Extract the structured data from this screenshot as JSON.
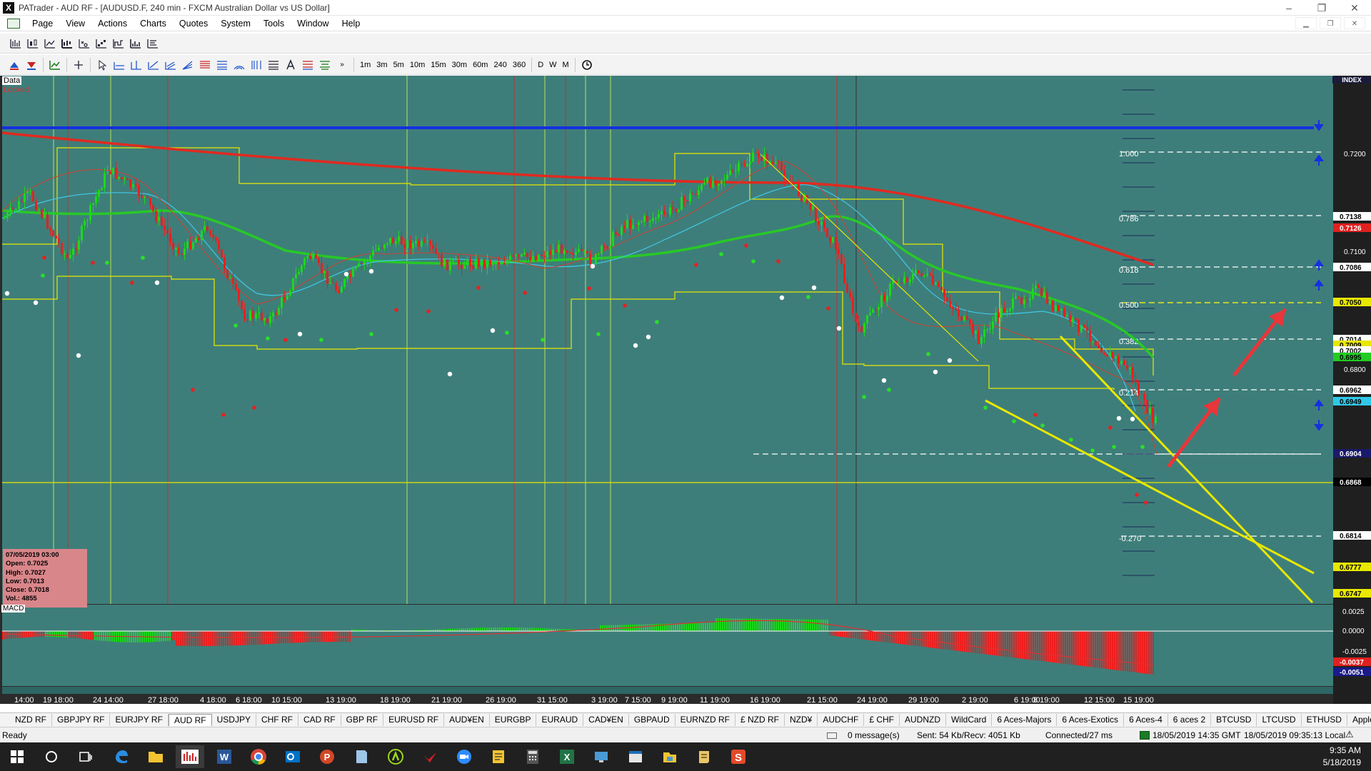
{
  "window": {
    "title": "PATrader - AUD RF - [AUDUSD.F, 240 min - FXCM Australian Dollar vs US Dollar]",
    "controls": [
      "–",
      "❐",
      "✕"
    ]
  },
  "menu": [
    "Page",
    "View",
    "Actions",
    "Charts",
    "Quotes",
    "System",
    "Tools",
    "Window",
    "Help"
  ],
  "timeframes": [
    "1m",
    "3m",
    "5m",
    "10m",
    "15m",
    "30m",
    "60m",
    "240",
    "360"
  ],
  "periods": [
    "D",
    "W",
    "M"
  ],
  "chart": {
    "data_label": "Data",
    "locked_label": "Locked",
    "index_label": "INDEX",
    "macd_label": "MACD",
    "ohlc": {
      "date": "07/05/2019 03:00",
      "open": "Open: 0.7025",
      "high": "High: 0.7027",
      "low": "Low: 0.7013",
      "close": "Close: 0.7018",
      "vol": "Vol.: 4855"
    },
    "price_axis": [
      "0.7200",
      "0.7100",
      "0.6800"
    ],
    "price_markers": [
      {
        "label": "0.7138",
        "bg": "#ffffff",
        "fg": "#000000"
      },
      {
        "label": "0.7126",
        "bg": "#e02020",
        "fg": "#ffffff"
      },
      {
        "label": "0.7086",
        "bg": "#ffffff",
        "fg": "#000000"
      },
      {
        "label": "0.7050",
        "bg": "#e8e800",
        "fg": "#000000"
      },
      {
        "label": "0.7014",
        "bg": "#ffffff",
        "fg": "#000000"
      },
      {
        "label": "0.7009",
        "bg": "#e8e800",
        "fg": "#000000"
      },
      {
        "label": "0.7002",
        "bg": "#ffffff",
        "fg": "#000000"
      },
      {
        "label": "0.6995",
        "bg": "#22cc22",
        "fg": "#000000"
      },
      {
        "label": "0.6962",
        "bg": "#ffffff",
        "fg": "#000000"
      },
      {
        "label": "0.6949",
        "bg": "#30c8e8",
        "fg": "#000000"
      },
      {
        "label": "0.6904",
        "bg": "#1a1a6a",
        "fg": "#ffffff"
      },
      {
        "label": "0.6868",
        "bg": "#000000",
        "fg": "#ffffff"
      },
      {
        "label": "0.6814",
        "bg": "#ffffff",
        "fg": "#000000"
      },
      {
        "label": "0.6777",
        "bg": "#e8e800",
        "fg": "#000000"
      },
      {
        "label": "0.6747",
        "bg": "#e8e800",
        "fg": "#000000"
      }
    ],
    "fib_levels": [
      "1.000",
      "0.786",
      "0.618",
      "0.500",
      "0.382",
      "0.214",
      "-0.270"
    ],
    "macd_axis": [
      "0.0025",
      "0.0000",
      "-0.0025"
    ],
    "macd_markers": [
      {
        "label": "-0.0037",
        "bg": "#e02020",
        "fg": "#ffffff"
      },
      {
        "label": "-0.0051",
        "bg": "#1a1a8a",
        "fg": "#ffffff"
      }
    ],
    "time_labels": [
      "14:00",
      "19 18:00",
      "24 14:00",
      "27 18:00",
      "4 18:00",
      "6 18:00",
      "10 15:00",
      "13 19:00",
      "18 19:00",
      "21 19:00",
      "26 19:00",
      "31 15:00",
      "3 19:00",
      "7 15:00",
      "9 19:00",
      "11 19:00",
      "16 19:00",
      "21 15:00",
      "24 19:00",
      "29 19:00",
      "2 19:00",
      "6 19:00",
      "8 19:00",
      "12 15:00",
      "15 19:00"
    ]
  },
  "tabs": [
    "NZD RF",
    "GBPJPY RF",
    "EURJPY RF",
    "AUD RF",
    "USDJPY",
    "CHF RF",
    "CAD RF",
    "GBP RF",
    "EURUSD RF",
    "AUD¥EN",
    "EURGBP",
    "EURAUD",
    "CAD¥EN",
    "GBPAUD",
    "EURNZD RF",
    "£ NZD RF",
    "NZD¥",
    "AUDCHF",
    "£ CHF",
    "AUDNZD",
    "WildCard",
    "6 Aces-Majors",
    "6 Aces-Exotics",
    "6 Aces-4",
    "6 aces 2",
    "BTCUSD",
    "LTCUSD",
    "ETHUSD",
    "Apple"
  ],
  "active_tab": "AUD RF",
  "status": {
    "ready": "Ready",
    "messages": "0 message(s)",
    "traffic": "Sent: 54 Kb/Recv: 4051 Kb",
    "connection": "Connected/27 ms",
    "server_time": "18/05/2019 14:35 GMT",
    "local_time": "18/05/2019 09:35:13 Local"
  },
  "taskbar": {
    "time": "9:35 AM",
    "date": "5/18/2019"
  }
}
